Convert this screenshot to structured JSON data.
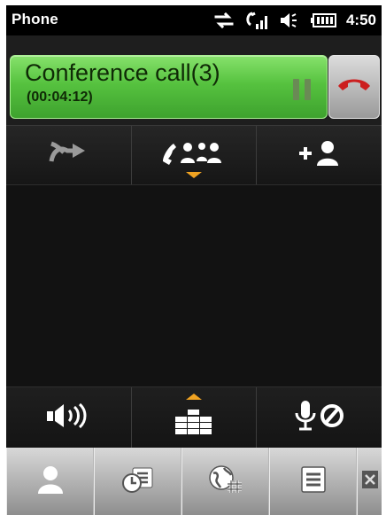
{
  "statusbar": {
    "app_title": "Phone",
    "clock": "4:50",
    "icons": [
      "data-transfer-icon",
      "signal-icon",
      "speaker-volume-icon",
      "battery-icon"
    ]
  },
  "call": {
    "title": "Conference call(3)",
    "timer": "(00:04:12)",
    "pill_color": "#56c23f",
    "hold_icon": "pause-icon",
    "end_call_icon": "hang-up-icon",
    "end_call_color": "#cc1f1f"
  },
  "top_toolbar": {
    "items": [
      "transfer-icon",
      "conference-participants-icon",
      "add-participant-icon"
    ]
  },
  "bottom_toolbar": {
    "items": [
      "speakerphone-icon",
      "keypad-icon",
      "mute-microphone-icon"
    ]
  },
  "softkeys": {
    "items": [
      "contacts-icon",
      "call-history-icon",
      "speed-dial-icon",
      "menu-icon",
      "close-icon"
    ]
  },
  "accent_color": "#f0a322"
}
